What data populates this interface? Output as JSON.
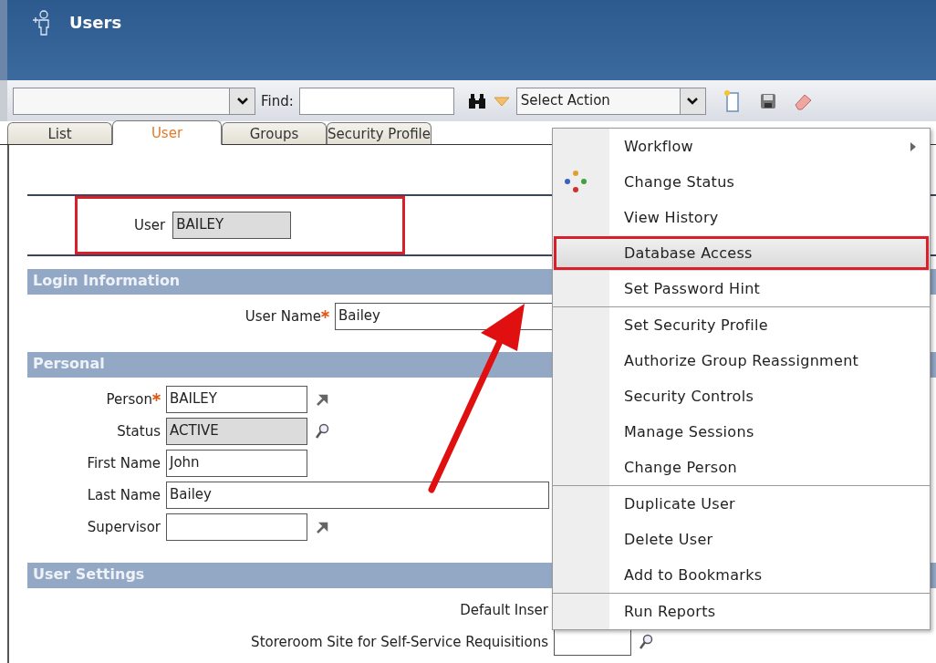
{
  "window": {
    "title": "Users"
  },
  "toolbar": {
    "find": {
      "label": "Find:"
    },
    "action_select": {
      "value": "Select Action"
    }
  },
  "tabs": [
    {
      "label": "List",
      "selected": false
    },
    {
      "label": "User",
      "selected": true
    },
    {
      "label": "Groups",
      "selected": false
    },
    {
      "label": "Security Profile",
      "selected": false
    }
  ],
  "record": {
    "label": "User",
    "value": "BAILEY",
    "readonly": true
  },
  "sections": [
    {
      "kind": "login",
      "title": "Login Information",
      "fields": [
        {
          "label": "User Name",
          "required": true,
          "kind": "plain",
          "input": {
            "value": "Bailey",
            "readonly": false,
            "wide": true
          }
        }
      ]
    },
    {
      "kind": "personal",
      "title": "Personal",
      "fields": [
        {
          "label": "Person",
          "required": true,
          "kind": "goto",
          "input": {
            "value": "BAILEY",
            "readonly": false,
            "wide": false
          }
        },
        {
          "label": "Status",
          "required": false,
          "kind": "lookup",
          "input": {
            "value": "ACTIVE",
            "readonly": true,
            "wide": false
          }
        },
        {
          "label": "First Name",
          "required": false,
          "kind": "plain",
          "input": {
            "value": "John",
            "readonly": false,
            "wide": false
          }
        },
        {
          "label": "Last Name",
          "required": false,
          "kind": "plain",
          "input": {
            "value": "Bailey",
            "readonly": false,
            "wide": true
          }
        },
        {
          "label": "Supervisor",
          "required": false,
          "kind": "goto",
          "input": {
            "readonly": false,
            "wide": false
          }
        }
      ]
    },
    {
      "kind": "settings",
      "title": "User Settings",
      "fields": [
        {
          "label": "Default Inser",
          "required": false,
          "kind": "plain"
        },
        {
          "label": "Storeroom Site for Self-Service Requisitions",
          "required": false,
          "kind": "lookup",
          "input": {
            "readonly": false,
            "wide": false
          }
        }
      ]
    }
  ],
  "menu": {
    "groups": [
      [
        {
          "label": "Workflow",
          "kind": "submenu",
          "selected": false
        },
        {
          "label": "Change Status",
          "kind": "status",
          "selected": false
        },
        {
          "label": "View History",
          "kind": "plain",
          "selected": false
        },
        {
          "label": "Database Access",
          "kind": "plain",
          "selected": true
        },
        {
          "label": "Set Password Hint",
          "kind": "plain",
          "selected": false
        }
      ],
      [
        {
          "label": "Set Security Profile",
          "kind": "plain",
          "selected": false
        },
        {
          "label": "Authorize Group Reassignment",
          "kind": "plain",
          "selected": false
        },
        {
          "label": "Security Controls",
          "kind": "plain",
          "selected": false
        },
        {
          "label": "Manage Sessions",
          "kind": "plain",
          "selected": false
        },
        {
          "label": "Change Person",
          "kind": "plain",
          "selected": false
        }
      ],
      [
        {
          "label": "Duplicate User",
          "kind": "plain",
          "selected": false
        },
        {
          "label": "Delete User",
          "kind": "plain",
          "selected": false
        },
        {
          "label": "Add to Bookmarks",
          "kind": "plain",
          "selected": false
        }
      ],
      [
        {
          "label": "Run Reports",
          "kind": "plain",
          "selected": false
        }
      ]
    ]
  }
}
